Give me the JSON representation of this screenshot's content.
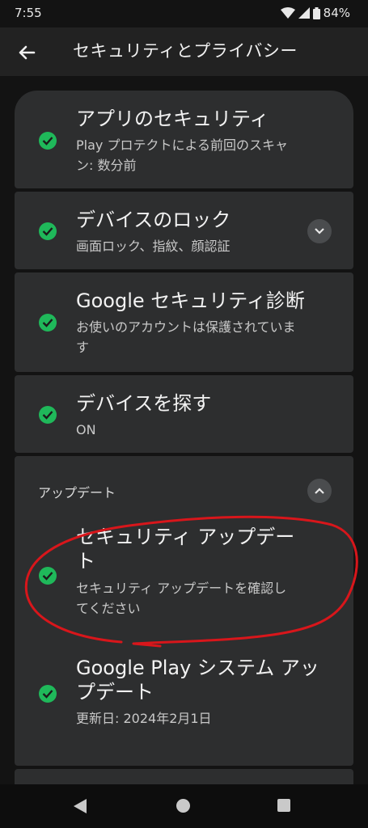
{
  "status": {
    "time": "7:55",
    "battery": "84%"
  },
  "header": {
    "title": "セキュリティとプライバシー"
  },
  "items": [
    {
      "title": "アプリのセキュリティ",
      "subtitle_line1": "Play プロテクトによる前回のスキャ",
      "subtitle_line2": "ン: 数分前"
    },
    {
      "title": "デバイスのロック",
      "subtitle": "画面ロック、指紋、顔認証"
    },
    {
      "title": "Google セキュリティ診断",
      "subtitle_line1": "お使いのアカウントは保護されていま",
      "subtitle_line2": "す"
    },
    {
      "title": "デバイスを探す",
      "subtitle": "ON"
    }
  ],
  "updates": {
    "header": "アップデート",
    "security": {
      "title_line1": "セキュリティ アップデー",
      "title_line2": "ト",
      "subtitle_line1": "セキュリティ アップデートを確認し",
      "subtitle_line2": "てください"
    },
    "play": {
      "title_line1": "Google Play システム アッ",
      "title_line2": "プデート",
      "subtitle": "更新日: 2024年2月1日"
    }
  },
  "colors": {
    "check": "#1fb85a",
    "annotation": "#d8161b",
    "card": "#2d2e2f"
  }
}
